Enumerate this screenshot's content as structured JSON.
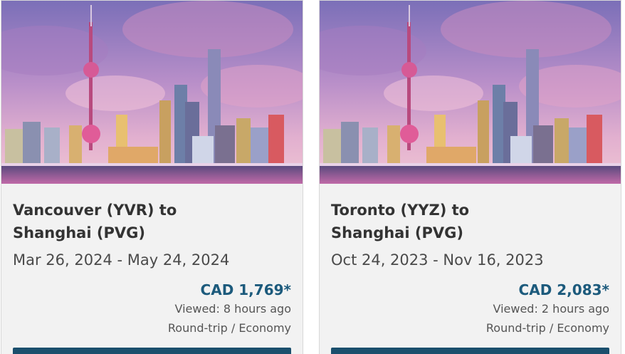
{
  "cards": [
    {
      "image_alt": "Shanghai skyline at dusk",
      "route_line1": "Vancouver (YVR) to",
      "route_line2": "Shanghai (PVG)",
      "dates": "Mar 26, 2024 - May 24, 2024",
      "price": "CAD 1,769*",
      "viewed": "Viewed: 8 hours ago",
      "trip": "Round-trip / Economy"
    },
    {
      "image_alt": "Shanghai skyline at dusk",
      "route_line1": "Toronto (YYZ) to",
      "route_line2": "Shanghai (PVG)",
      "dates": "Oct 24, 2023 - Nov 16, 2023",
      "price": "CAD 2,083*",
      "viewed": "Viewed: 2 hours ago",
      "trip": "Round-trip / Economy"
    }
  ],
  "colors": {
    "card_background": "#f2f2f2",
    "price": "#1c5a7c",
    "button": "#1b4f6d",
    "title": "#333333"
  }
}
